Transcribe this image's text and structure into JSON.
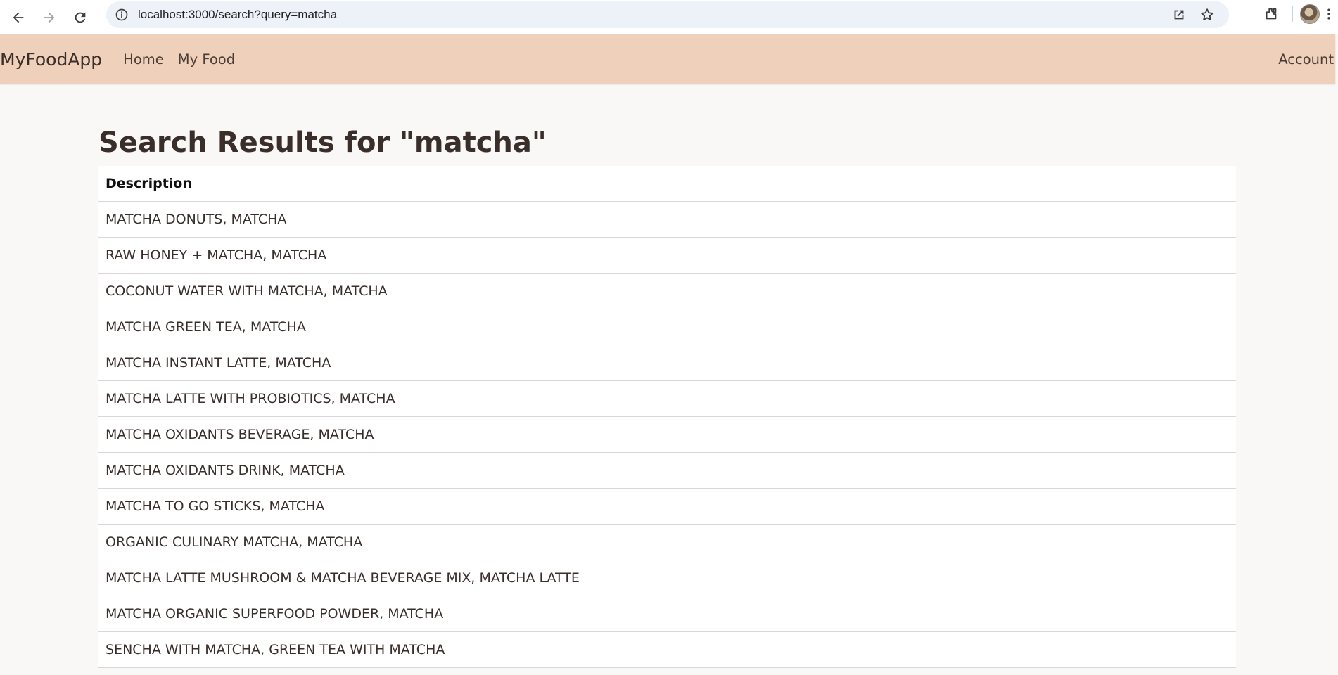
{
  "browser": {
    "url": "localhost:3000/search?query=matcha",
    "icons": [
      "back-icon",
      "forward-icon",
      "reload-icon",
      "info-icon",
      "open-in-new-icon",
      "star-icon",
      "extensions-icon",
      "profile-avatar",
      "more-menu-icon"
    ]
  },
  "navbar": {
    "brand": "MyFoodApp",
    "links": [
      "Home",
      "My Food"
    ],
    "account": "Account",
    "background": "#efd0bb"
  },
  "page": {
    "title": "Search Results for \"matcha\""
  },
  "table": {
    "headers": [
      "Description"
    ],
    "rows": [
      "MATCHA DONUTS, MATCHA",
      "RAW HONEY + MATCHA, MATCHA",
      "COCONUT WATER WITH MATCHA, MATCHA",
      "MATCHA GREEN TEA, MATCHA",
      "MATCHA INSTANT LATTE, MATCHA",
      "MATCHA LATTE WITH PROBIOTICS, MATCHA",
      "MATCHA OXIDANTS BEVERAGE, MATCHA",
      "MATCHA OXIDANTS DRINK, MATCHA",
      "MATCHA TO GO STICKS, MATCHA",
      "ORGANIC CULINARY MATCHA, MATCHA",
      "MATCHA LATTE MUSHROOM & MATCHA BEVERAGE MIX, MATCHA LATTE",
      "MATCHA ORGANIC SUPERFOOD POWDER, MATCHA",
      "SENCHA WITH MATCHA, GREEN TEA WITH MATCHA"
    ]
  }
}
